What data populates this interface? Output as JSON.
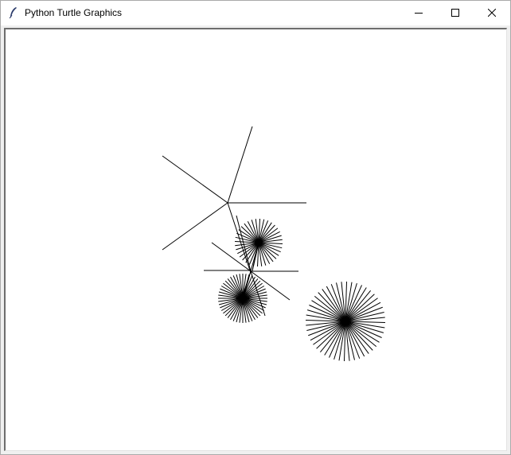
{
  "window": {
    "title": "Python Turtle Graphics",
    "app_icon": "feather-icon",
    "controls": {
      "minimize_icon": "minimize-icon",
      "maximize_icon": "maximize-icon",
      "close_icon": "close-icon"
    }
  },
  "canvas": {
    "background": "#ffffff",
    "stroke": "#000000"
  }
}
